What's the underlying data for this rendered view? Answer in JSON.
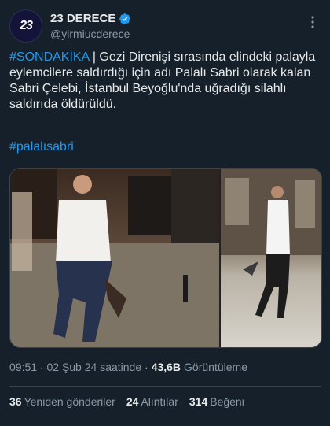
{
  "account": {
    "avatar_text": "23",
    "name": "23 DERECE",
    "handle": "@yirmiucderece"
  },
  "tweet": {
    "hashtag_lead": "#SONDAKİKA",
    "body": " | Gezi Direnişi sırasında elindeki palayla eylemcilere saldırdığı için adı Palalı Sabri olarak kalan Sabri Çelebi, İstanbul Beyoğlu'nda uğradığı silahlı saldırıda öldürüldü.",
    "hashtag_tail": "#palalısabri"
  },
  "meta": {
    "time": "09:51 · 02 Şub 24 saatinde ·",
    "views_value": "43,6B",
    "views_label": "Görüntüleme"
  },
  "stats": {
    "retweets_value": "36",
    "retweets_label": "Yeniden gönderiler",
    "quotes_value": "24",
    "quotes_label": "Alıntılar",
    "likes_value": "314",
    "likes_label": "Beğeni"
  },
  "colors": {
    "background": "#15202b",
    "link": "#1d9bf0",
    "verified": "#1d9bf0"
  }
}
